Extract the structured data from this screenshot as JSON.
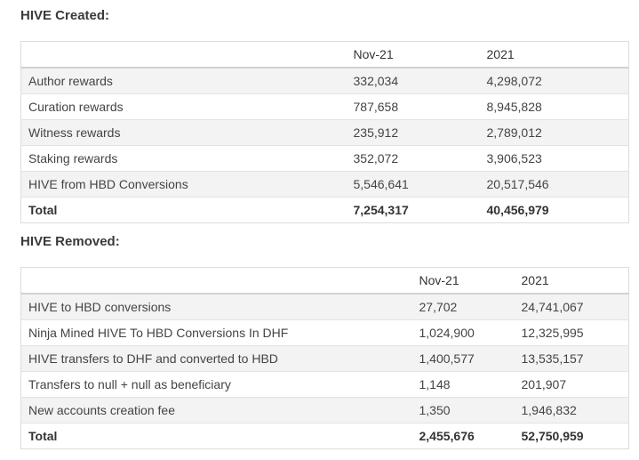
{
  "created": {
    "title": "HIVE Created:",
    "columns": [
      "",
      "Nov-21",
      "2021"
    ],
    "rows": [
      {
        "label": "Author rewards",
        "nov21": "332,034",
        "y2021": "4,298,072"
      },
      {
        "label": "Curation rewards",
        "nov21": "787,658",
        "y2021": "8,945,828"
      },
      {
        "label": "Witness rewards",
        "nov21": "235,912",
        "y2021": "2,789,012"
      },
      {
        "label": "Staking rewards",
        "nov21": "352,072",
        "y2021": "3,906,523"
      },
      {
        "label": "HIVE from HBD Conversions",
        "nov21": "5,546,641",
        "y2021": "20,517,546"
      }
    ],
    "total": {
      "label": "Total",
      "nov21": "7,254,317",
      "y2021": "40,456,979"
    }
  },
  "removed": {
    "title": "HIVE Removed:",
    "columns": [
      "",
      "Nov-21",
      "2021"
    ],
    "rows": [
      {
        "label": "HIVE to HBD conversions",
        "nov21": "27,702",
        "y2021": "24,741,067"
      },
      {
        "label": "Ninja Mined HIVE To HBD Conversions In DHF",
        "nov21": "1,024,900",
        "y2021": "12,325,995"
      },
      {
        "label": "HIVE transfers to DHF and converted to HBD",
        "nov21": "1,400,577",
        "y2021": "13,535,157"
      },
      {
        "label": "Transfers to null + null as beneficiary",
        "nov21": "1,148",
        "y2021": "201,907"
      },
      {
        "label": "New accounts creation fee",
        "nov21": "1,350",
        "y2021": "1,946,832"
      }
    ],
    "total": {
      "label": "Total",
      "nov21": "2,455,676",
      "y2021": "52,750,959"
    }
  }
}
